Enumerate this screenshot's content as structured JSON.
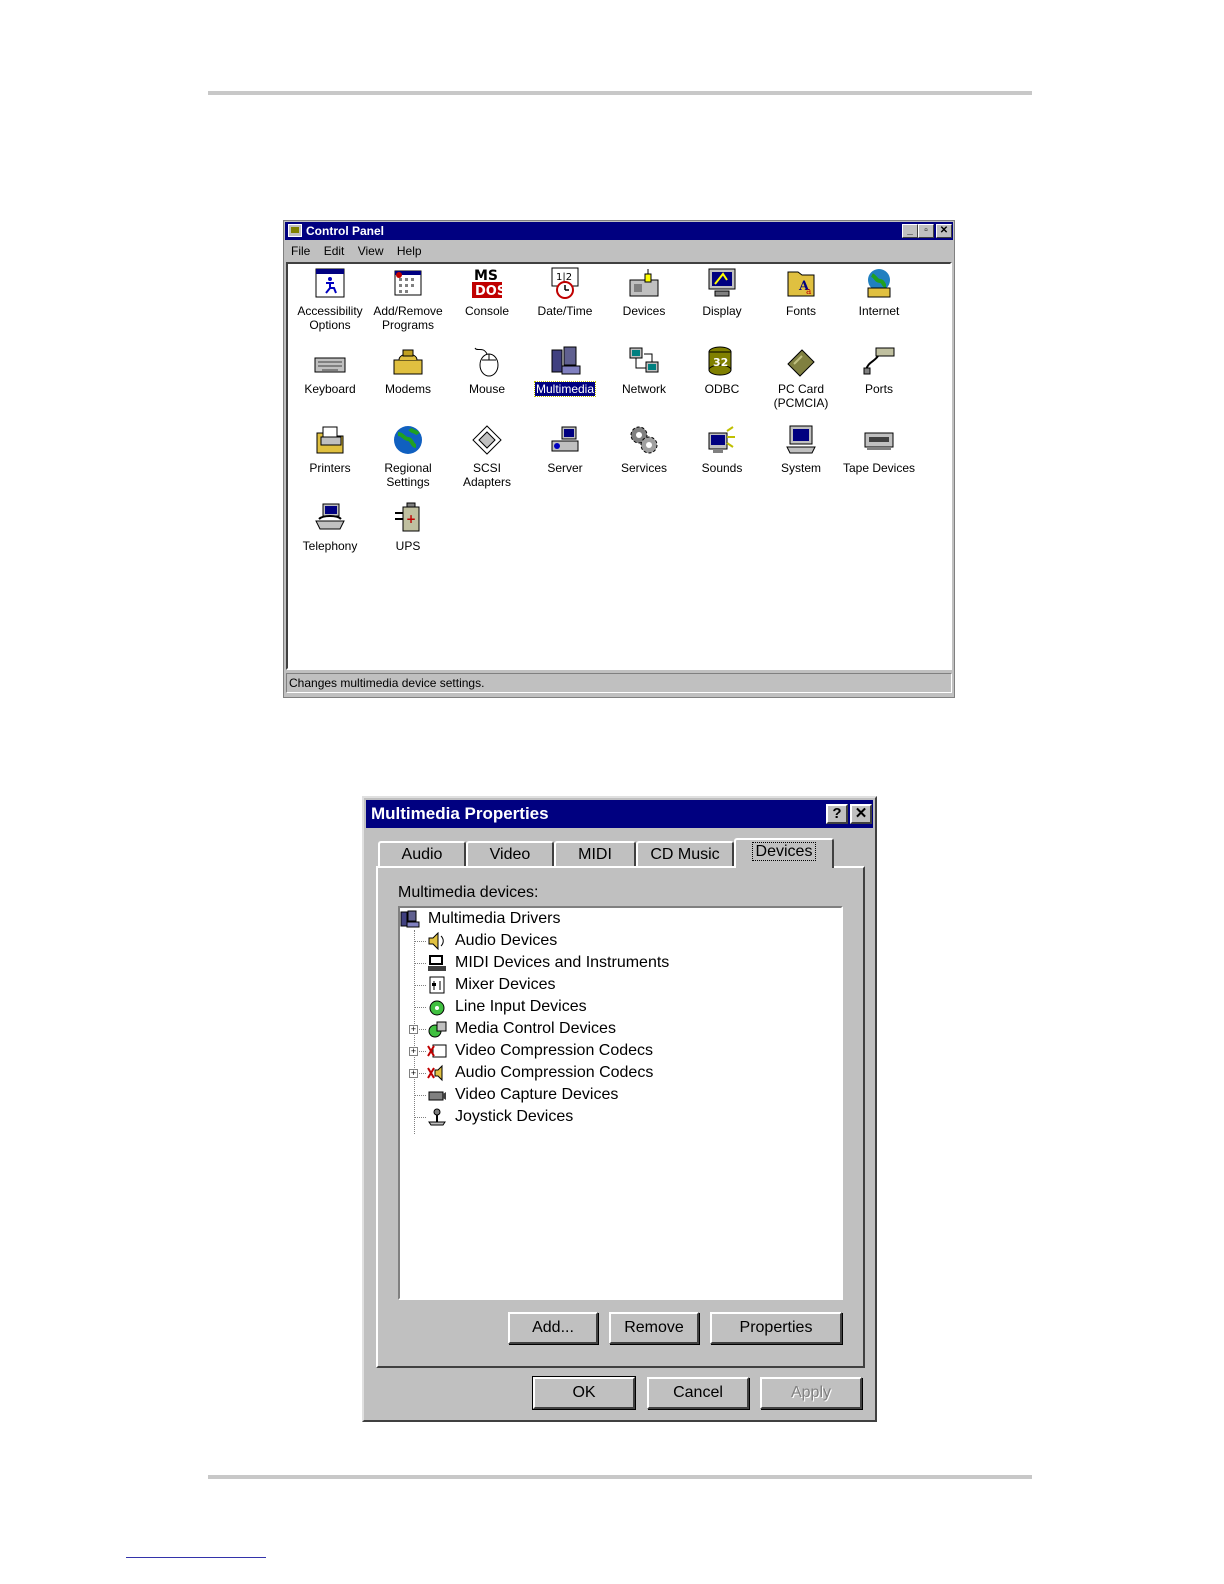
{
  "control_panel": {
    "title": "Control Panel",
    "menu": [
      "File",
      "Edit",
      "View",
      "Help"
    ],
    "items": [
      {
        "label": "Accessibility\nOptions",
        "icon": "accessibility-icon"
      },
      {
        "label": "Add/Remove\nPrograms",
        "icon": "add-remove-programs-icon"
      },
      {
        "label": "Console",
        "icon": "console-icon"
      },
      {
        "label": "Date/Time",
        "icon": "date-time-icon"
      },
      {
        "label": "Devices",
        "icon": "devices-icon"
      },
      {
        "label": "Display",
        "icon": "display-icon"
      },
      {
        "label": "Fonts",
        "icon": "fonts-icon"
      },
      {
        "label": "Internet",
        "icon": "internet-icon"
      },
      {
        "label": "Keyboard",
        "icon": "keyboard-icon"
      },
      {
        "label": "Modems",
        "icon": "modems-icon"
      },
      {
        "label": "Mouse",
        "icon": "mouse-icon"
      },
      {
        "label": "Multimedia",
        "icon": "multimedia-icon",
        "selected": true
      },
      {
        "label": "Network",
        "icon": "network-icon"
      },
      {
        "label": "ODBC",
        "icon": "odbc-icon"
      },
      {
        "label": "PC Card\n(PCMCIA)",
        "icon": "pc-card-icon"
      },
      {
        "label": "Ports",
        "icon": "ports-icon"
      },
      {
        "label": "Printers",
        "icon": "printers-icon"
      },
      {
        "label": "Regional\nSettings",
        "icon": "regional-settings-icon"
      },
      {
        "label": "SCSI Adapters",
        "icon": "scsi-adapters-icon"
      },
      {
        "label": "Server",
        "icon": "server-icon"
      },
      {
        "label": "Services",
        "icon": "services-icon"
      },
      {
        "label": "Sounds",
        "icon": "sounds-icon"
      },
      {
        "label": "System",
        "icon": "system-icon"
      },
      {
        "label": "Tape Devices",
        "icon": "tape-devices-icon"
      },
      {
        "label": "Telephony",
        "icon": "telephony-icon"
      },
      {
        "label": "UPS",
        "icon": "ups-icon"
      }
    ],
    "status": "Changes multimedia device settings."
  },
  "multimedia": {
    "title": "Multimedia Properties",
    "tabs": [
      "Audio",
      "Video",
      "MIDI",
      "CD Music",
      "Devices"
    ],
    "active_tab": "Devices",
    "devices_label": "Multimedia devices:",
    "tree": {
      "root": "Multimedia Drivers",
      "children": [
        {
          "label": "Audio Devices",
          "expandable": false
        },
        {
          "label": "MIDI Devices and Instruments",
          "expandable": false
        },
        {
          "label": "Mixer Devices",
          "expandable": false
        },
        {
          "label": "Line Input Devices",
          "expandable": false
        },
        {
          "label": "Media Control Devices",
          "expandable": true
        },
        {
          "label": "Video Compression Codecs",
          "expandable": true
        },
        {
          "label": "Audio Compression Codecs",
          "expandable": true
        },
        {
          "label": "Video Capture Devices",
          "expandable": false
        },
        {
          "label": "Joystick Devices",
          "expandable": false
        }
      ]
    },
    "buttons": {
      "add": "Add...",
      "remove": "Remove",
      "properties": "Properties",
      "ok": "OK",
      "cancel": "Cancel",
      "apply": "Apply"
    },
    "title_help": "?",
    "title_close": "✕"
  },
  "window_controls": {
    "minimize": "_",
    "restore": "▫",
    "close": "✕"
  }
}
